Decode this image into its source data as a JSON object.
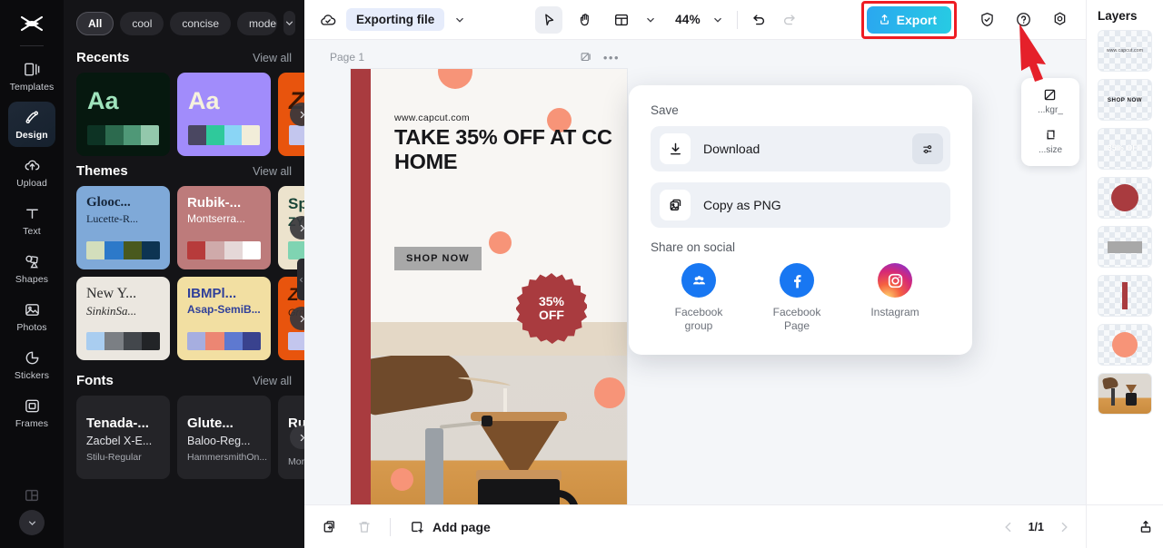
{
  "rail": {
    "logo_icon": "capcut-logo-icon",
    "items": [
      {
        "label": "Templates",
        "icon": "templates-icon",
        "active": false
      },
      {
        "label": "Design",
        "icon": "design-icon",
        "active": true
      },
      {
        "label": "Upload",
        "icon": "upload-cloud-icon",
        "active": false
      },
      {
        "label": "Text",
        "icon": "text-icon",
        "active": false
      },
      {
        "label": "Shapes",
        "icon": "shapes-icon",
        "active": false
      },
      {
        "label": "Photos",
        "icon": "photos-icon",
        "active": false
      },
      {
        "label": "Stickers",
        "icon": "stickers-icon",
        "active": false
      },
      {
        "label": "Frames",
        "icon": "frames-icon",
        "active": false
      }
    ],
    "more_icon": "chevron-down-icon"
  },
  "panel": {
    "chips": [
      "All",
      "cool",
      "concise",
      "modern"
    ],
    "chips_more_icon": "chevron-down-icon",
    "sections": [
      {
        "title": "Recents",
        "view_all": "View all",
        "cards": [
          {
            "aa": "Aa",
            "bg": "#06180f",
            "fg": "#9fe3bc",
            "swatches": [
              "#0d3324",
              "#2c6a4e",
              "#4f9877",
              "#93c8ac"
            ]
          },
          {
            "aa": "Aa",
            "bg": "#a18cfb",
            "fg": "#f6f2dd",
            "swatches": [
              "#4a4761",
              "#2fc99b",
              "#8ad5f5",
              "#f2edd9"
            ]
          },
          {
            "aa": "Z",
            "bg": "#e8540d",
            "fg": "#3a1503",
            "swatches": [
              "#c3c6ee",
              "#c3c6ee",
              "#c3c6ee",
              "#c3c6ee"
            ]
          }
        ]
      },
      {
        "title": "Themes",
        "view_all": "View all",
        "cards": [
          {
            "t1": "Glooc...",
            "t2": "Lucette-R...",
            "bg": "#7fa9d8",
            "fg": "#16263b",
            "swatches": [
              "#d3debc",
              "#2c79c9",
              "#49591e",
              "#0d3452"
            ]
          },
          {
            "t1": "Rubik-...",
            "t2": "Montserra...",
            "bg": "#bd7b7b",
            "fg": "#ffffff",
            "swatches": [
              "#b73b3b",
              "#cfaaaa",
              "#e5d8d8",
              "#ffffff"
            ]
          },
          {
            "t1": "Sp",
            "t2": "ZY",
            "bg": "#ece3cd",
            "fg": "#184437",
            "swatches": [
              "#7fd4b2",
              "#7fd4b2",
              "#7fd4b2",
              "#7fd4b2"
            ]
          },
          {
            "t1": "New Y...",
            "t2": "SinkinSa...",
            "bg": "#ebe7e0",
            "fg": "#2b2b2b",
            "swatches": [
              "#a9cdf0",
              "#7b7f84",
              "#43474c",
              "#222427"
            ]
          },
          {
            "t1": "IBMPl...",
            "t2": "Asap-SemiB...",
            "bg": "#f2dfa2",
            "fg": "#30409a",
            "swatches": [
              "#a6aee0",
              "#ec8673",
              "#5e79d0",
              "#39428e"
            ]
          },
          {
            "t1": "Z",
            "t2": "Gro",
            "bg": "#e8540d",
            "fg": "#3a1503",
            "swatches": [
              "#c3c6ee",
              "#c3c6ee",
              "#c3c6ee",
              "#c3c6ee"
            ]
          }
        ]
      },
      {
        "title": "Fonts",
        "view_all": "View all",
        "cards": [
          {
            "l1": "Tenada-...",
            "l2": "Zacbel X-E...",
            "l3": "Stilu-Regular"
          },
          {
            "l1": "Glute...",
            "l2": "Baloo-Reg...",
            "l3": "HammersmithOn..."
          },
          {
            "l1": "Ru",
            "l2": "",
            "l3": "Mor"
          }
        ]
      }
    ],
    "next_arrow_icon": "chevron-right-icon",
    "grip_icon": "collapse-panel-icon"
  },
  "topbar": {
    "cloud_icon": "cloud-sync-icon",
    "file_status": "Exporting file",
    "file_caret_icon": "chevron-down-icon",
    "select_tool_icon": "cursor-select-icon",
    "hand_tool_icon": "hand-pan-icon",
    "layout_tool_icon": "layout-grid-icon",
    "layout_caret_icon": "chevron-down-icon",
    "zoom_level": "44%",
    "zoom_caret_icon": "chevron-down-icon",
    "undo_icon": "undo-icon",
    "redo_icon": "redo-icon",
    "export_label": "Export",
    "export_icon": "share-upload-icon",
    "shield_icon": "shield-check-icon",
    "help_icon": "help-circle-icon",
    "settings_icon": "settings-gear-icon"
  },
  "canvas": {
    "page_label": "Page 1",
    "page_image_icon": "image-placeholder-icon",
    "page_more_icon": "more-horizontal-icon",
    "design": {
      "url_text": "www.capcut.com",
      "headline": "TAKE 35% OFF AT CC HOME",
      "cta": "SHOP NOW",
      "badge_line1": "35%",
      "badge_line2": "OFF",
      "stripe_color": "#a93b3f",
      "accent_dot_color": "#f79478",
      "badge_color": "#a93b3f"
    },
    "float_tools": [
      {
        "label": "...kgr_",
        "icon": "background-icon"
      },
      {
        "label": "...size",
        "icon": "resize-icon"
      }
    ]
  },
  "export_popup": {
    "save_heading": "Save",
    "download_label": "Download",
    "download_icon": "download-icon",
    "download_settings_icon": "sliders-icon",
    "copy_png_label": "Copy as PNG",
    "copy_png_icon": "copy-image-icon",
    "share_heading": "Share on social",
    "socials": [
      {
        "label": "Facebook group",
        "icon": "facebook-group-icon",
        "color": "#1877f2"
      },
      {
        "label": "Facebook Page",
        "icon": "facebook-icon",
        "color": "#1877f2"
      },
      {
        "label": "Instagram",
        "icon": "instagram-icon",
        "color": "#d62976"
      }
    ]
  },
  "bottombar": {
    "duplicate_icon": "duplicate-page-icon",
    "delete_icon": "trash-icon",
    "add_page_label": "Add page",
    "add_page_icon": "add-page-icon",
    "prev_icon": "chevron-left-icon",
    "page_count": "1/1",
    "next_icon": "chevron-right-icon",
    "export_page_icon": "export-page-icon"
  },
  "layers": {
    "title": "Layers",
    "items": [
      {
        "name": "layer-url-text",
        "kind": "text",
        "text": "www.capcut.com"
      },
      {
        "name": "layer-shop-now",
        "kind": "text",
        "text": "SHOP NOW"
      },
      {
        "name": "layer-discount-text",
        "kind": "text",
        "text": "35% OFF"
      },
      {
        "name": "layer-badge-shape",
        "kind": "shape",
        "text": ""
      },
      {
        "name": "layer-gray-bar",
        "kind": "shape",
        "text": ""
      },
      {
        "name": "layer-red-stripe",
        "kind": "shape",
        "text": ""
      },
      {
        "name": "layer-peach-circle",
        "kind": "shape",
        "text": ""
      },
      {
        "name": "layer-coffee-photo",
        "kind": "image",
        "text": ""
      }
    ]
  }
}
